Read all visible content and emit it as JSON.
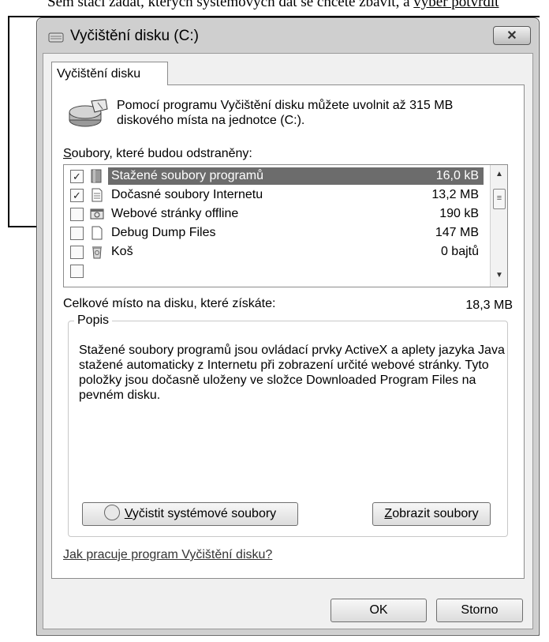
{
  "document": {
    "top_text_plain": "Sem stačí zadat, kterých systémových dat se chcete zbavit, a ",
    "top_text_underlined": "výběr potvrdit"
  },
  "window": {
    "title": "Vyčištění disku  (C:)",
    "close_label": "✕"
  },
  "tabs": [
    {
      "label": "Vyčištění disku"
    }
  ],
  "main": {
    "intro": "Pomocí programu Vyčištění disku můžete uvolnit až 315 MB diskového místa na jednotce  (C:).",
    "files_label_underlined": "S",
    "files_label_rest": "oubory, které budou odstraněny:",
    "files": [
      {
        "checked": true,
        "icon": "folder-icon",
        "label": "Stažené soubory programů",
        "size": "16,0 kB",
        "selected": true
      },
      {
        "checked": true,
        "icon": "document-icon",
        "label": "Dočasné soubory Internetu",
        "size": "13,2 MB",
        "selected": false
      },
      {
        "checked": false,
        "icon": "offline-page-icon",
        "label": "Webové stránky offline",
        "size": "190 kB",
        "selected": false
      },
      {
        "checked": false,
        "icon": "blank-file-icon",
        "label": "Debug Dump Files",
        "size": "147 MB",
        "selected": false
      },
      {
        "checked": false,
        "icon": "recycle-bin-icon",
        "label": "Koš",
        "size": "0 bajtů",
        "selected": false
      }
    ],
    "total_label": "Celkové místo na disku, které získáte:",
    "total_value": "18,3 MB",
    "description_title": "Popis",
    "description": "Stažené soubory programů jsou ovládací prvky ActiveX a aplety jazyka Java stažené automaticky z Internetu při zobrazení určité webové stránky. Tyto položky jsou dočasně uloženy ve složce Downloaded Program Files na pevném disku.",
    "clean_system_underlined": "V",
    "clean_system_rest": "yčistit systémové soubory",
    "show_files_underlined": "Z",
    "show_files_rest": "obrazit soubory",
    "help_link": "Jak pracuje program Vyčištění disku?"
  },
  "footer": {
    "ok_label": "OK",
    "cancel_label": "Storno"
  },
  "colors": {
    "selection": "#6c6c6c",
    "client_bg": "#f0f0f0"
  }
}
